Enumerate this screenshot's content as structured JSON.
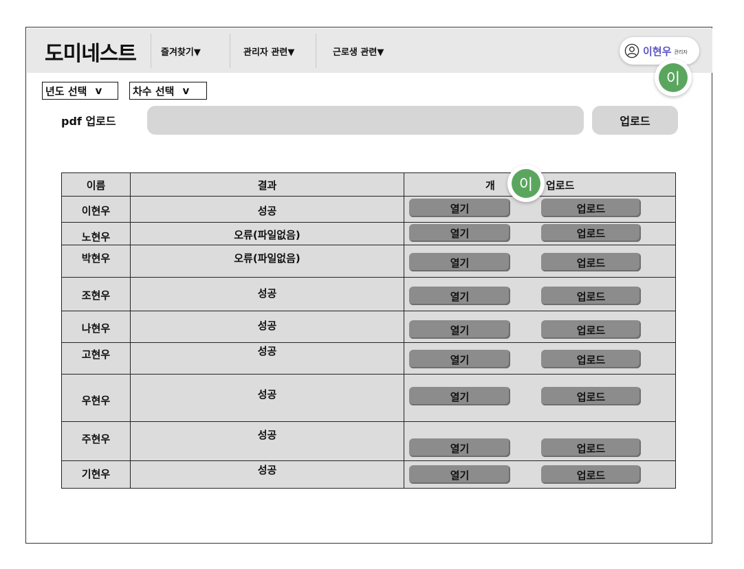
{
  "header": {
    "logo": "도미네스트",
    "nav": [
      {
        "label": "즐겨찾기▼"
      },
      {
        "label": "관리자 관련▼"
      },
      {
        "label": "근로생 관련▼"
      }
    ],
    "user": {
      "name": "이현우",
      "role": "관리자",
      "avatar_initial": "이"
    }
  },
  "filters": {
    "year": {
      "label": "년도 선택",
      "caret": "v"
    },
    "round": {
      "label": "차수 선택",
      "caret": "v"
    }
  },
  "pdf": {
    "label": "pdf 업로드",
    "upload_label": "업로드",
    "value": ""
  },
  "table": {
    "headers": {
      "name": "이름",
      "result": "결과",
      "actions_left": "개",
      "actions_right": "업로드"
    },
    "open_label": "열기",
    "upload_label": "업로드",
    "rows": [
      {
        "name": "이현우",
        "result": "성공"
      },
      {
        "name": "노현우",
        "result": "오류(파일없음)"
      },
      {
        "name": "박현우",
        "result": "오류(파일없음)"
      },
      {
        "name": "조현우",
        "result": "성공"
      },
      {
        "name": "나현우",
        "result": "성공"
      },
      {
        "name": "고현우",
        "result": "성공"
      },
      {
        "name": "우현우",
        "result": "성공"
      },
      {
        "name": "주현우",
        "result": "성공"
      },
      {
        "name": "기현우",
        "result": "성공"
      }
    ]
  },
  "colors": {
    "accent": "#5b54c8",
    "avatar_bg": "#5aa65e",
    "topbar_bg": "#e8e8e8",
    "button_bg": "#8c8c8c",
    "table_bg": "#dcdcdc"
  }
}
